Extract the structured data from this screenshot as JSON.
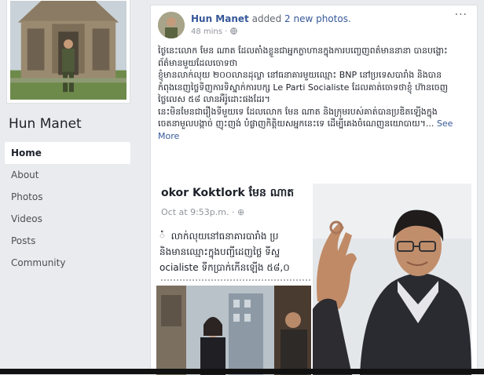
{
  "profile": {
    "name": "Hun Manet"
  },
  "nav": {
    "items": [
      {
        "label": "Home",
        "active": true
      },
      {
        "label": "About"
      },
      {
        "label": "Photos"
      },
      {
        "label": "Videos"
      },
      {
        "label": "Posts"
      },
      {
        "label": "Community"
      }
    ]
  },
  "post": {
    "author": "Hun Manet",
    "action": "added",
    "action_link": "2 new photos.",
    "time": "48 mins",
    "privacy_icon": "globe-icon",
    "more_label": "···",
    "text": "ថ្ងៃនេះលោក មែន ណាត ដែលតាំងខ្លួនជាអ្នកក្លាហានក្នុងការបញ្ចេញពត៌មាននានា បានបង្ហោះព័ត៌មានមួយដែលចោទថា\nខ្ញុំមានលាក់លុយ ២០០លានដុល្លា នៅធនាគារមួយឈ្មោះ BNP នៅប្រទេសបារាំង និងបានកំពុងនេញថ្លៃទិញការទិស្នាក់ការបក្ស Le Parti Socialiste ដែលគាត់ចោទថាខ្ញុំ ហ៊ានចេញថ្លៃលេស ៥៨ លានអឺរ៉ូដោះផងដែរ។\nនេះមិនមែនជារឿងទីមួយទេ ដែលលោក មែន ណាត និងក្រុមរបស់គាត់បានប្រឌិតឡើងក្នុងចេតនាមួលបង្កាច់ ញុះញង់ បំផ្លាញកិត្តិយសអ្នកនេះទេ ដើម្បីគេងចំណេញនយោបាយ។...",
    "see_more": "See More",
    "shared_name": "okor Koktlork មែន ណាត",
    "shared_time": "Oct at 9:53p.m. · ⊕",
    "shared_text": "ំ  លាក់លុយនៅធនាគារបារាំង ប្រ\nនិងមានឈ្មោះក្នុងបញ្ជីដេញថ្លៃ ទីស្ន\nocialiste ទីកប្រាក់កើនឡើង ៥៨,០"
  },
  "colors": {
    "link": "#365899",
    "page_bg": "#e9ebee",
    "card_border": "#dddfe2"
  }
}
